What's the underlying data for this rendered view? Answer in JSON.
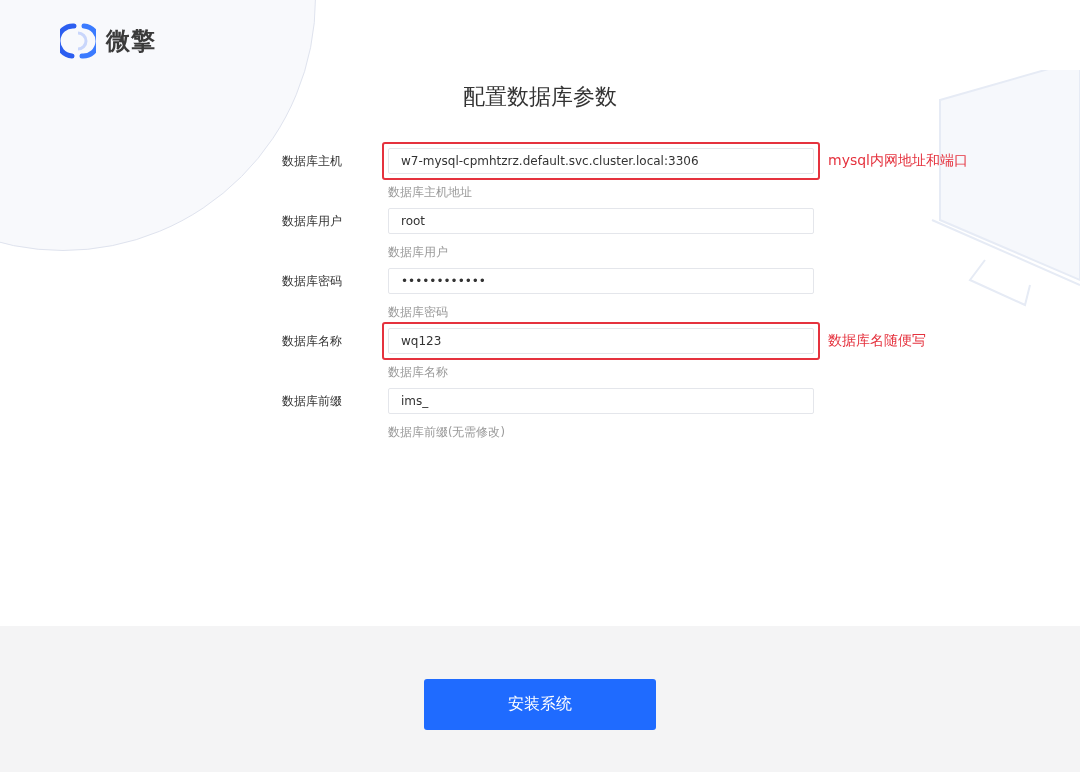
{
  "logo": {
    "text": "微擎"
  },
  "title": "配置数据库参数",
  "fields": [
    {
      "label": "数据库主机",
      "value": "w7-mysql-cpmhtzrz.default.svc.cluster.local:3306",
      "hint": "数据库主机地址",
      "highlighted": true,
      "note": "mysql内网地址和端口"
    },
    {
      "label": "数据库用户",
      "value": "root",
      "hint": "数据库用户",
      "highlighted": false
    },
    {
      "label": "数据库密码",
      "value": "••••••••••••",
      "hint": "数据库密码",
      "highlighted": false
    },
    {
      "label": "数据库名称",
      "value": "wq123",
      "hint": "数据库名称",
      "highlighted": true,
      "note": "数据库名随便写"
    },
    {
      "label": "数据库前缀",
      "value": "ims_",
      "hint": "数据库前缀(无需修改)",
      "highlighted": false
    }
  ],
  "submit_button": "安装系统"
}
